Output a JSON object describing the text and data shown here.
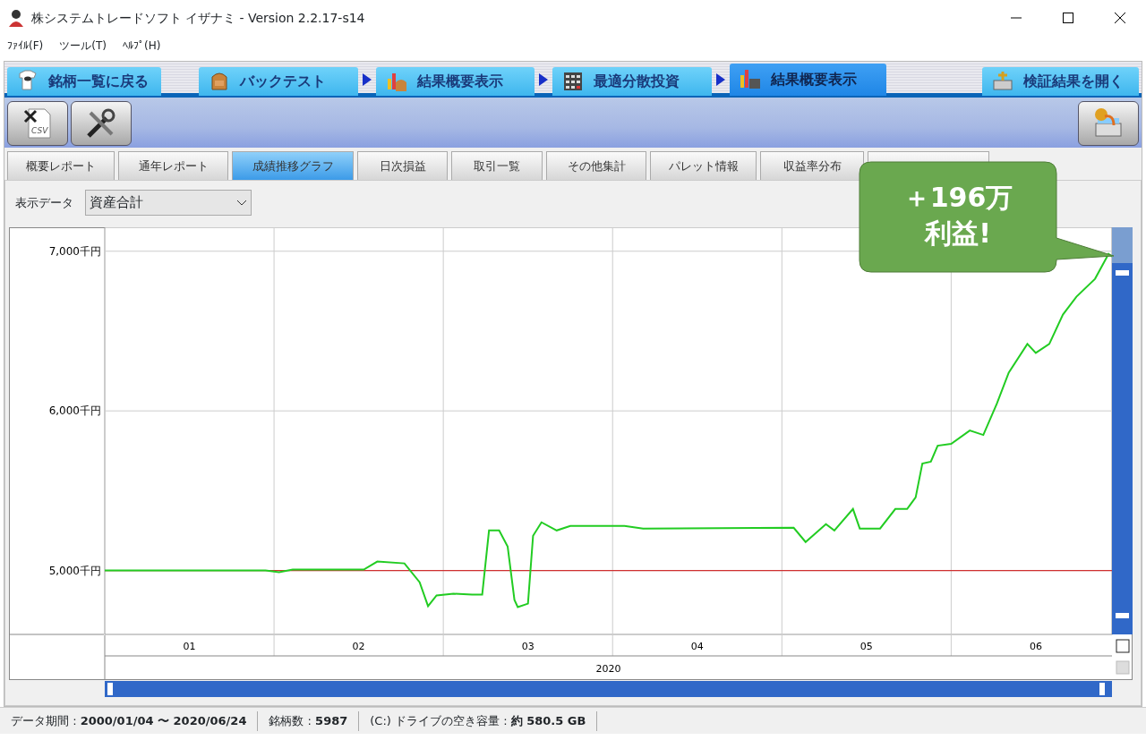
{
  "window": {
    "title": "株システムトレードソフト イザナミ - Version 2.2.17-s14"
  },
  "menu": [
    "ﾌｧｲﾙ(F)",
    "ツール(T)",
    "ﾍﾙﾌﾟ(H)"
  ],
  "workflow_tabs": [
    {
      "label": "銘柄一覧に戻る",
      "selected": false,
      "arrow": false
    },
    {
      "label": "バックテスト",
      "selected": false,
      "arrow": false
    },
    {
      "label": "結果概要表示",
      "selected": false,
      "arrow": true
    },
    {
      "label": "最適分散投資",
      "selected": false,
      "arrow": true
    },
    {
      "label": "結果概要表示",
      "selected": true,
      "arrow": true
    }
  ],
  "open_results_tab": {
    "label": "検証結果を開く"
  },
  "report_tabs": [
    {
      "label": "概要レポート",
      "selected": false
    },
    {
      "label": "通年レポート",
      "selected": false
    },
    {
      "label": "成績推移グラフ",
      "selected": true
    },
    {
      "label": "日次損益",
      "selected": false
    },
    {
      "label": "取引一覧",
      "selected": false
    },
    {
      "label": "その他集計",
      "selected": false
    },
    {
      "label": "パレット情報",
      "selected": false
    },
    {
      "label": "収益率分布",
      "selected": false
    },
    {
      "selected": false
    }
  ],
  "display_data": {
    "label": "表示データ",
    "value": "資産合計"
  },
  "toolbar": {
    "csv_label": "CSV"
  },
  "chart": {
    "chart_data": {
      "type": "line",
      "xlabel": "2020",
      "xlim": [
        0.5,
        6.45
      ],
      "ylim": [
        4600,
        7150
      ],
      "xticks": [
        {
          "value": 1,
          "label": "01"
        },
        {
          "value": 2,
          "label": "02"
        },
        {
          "value": 3,
          "label": "03"
        },
        {
          "value": 4,
          "label": "04"
        },
        {
          "value": 5,
          "label": "05"
        },
        {
          "value": 6,
          "label": "06"
        }
      ],
      "yticks": [
        {
          "value": 5000,
          "label": "5,000千円"
        },
        {
          "value": 6000,
          "label": "6,000千円"
        },
        {
          "value": 7000,
          "label": "7,000千円"
        }
      ],
      "x": [
        0.5,
        1.45,
        1.53,
        1.61,
        2.03,
        2.11,
        2.27,
        2.36,
        2.41,
        2.46,
        2.56,
        2.67,
        2.73,
        2.77,
        2.83,
        2.88,
        2.92,
        2.94,
        3,
        3.03,
        3.08,
        3.17,
        3.25,
        3.57,
        3.68,
        4.57,
        4.64,
        4.76,
        4.81,
        4.92,
        4.96,
        5.08,
        5.17,
        5.24,
        5.29,
        5.33,
        5.38,
        5.42,
        5.5,
        5.61,
        5.69,
        5.77,
        5.84,
        5.95,
        6,
        6.08,
        6.16,
        6.24,
        6.35,
        6.43,
        6.45
      ],
      "series": [
        {
          "color": "#22cc22",
          "values": [
            5000,
            5000,
            4989,
            5006,
            5006,
            5056,
            5045,
            4927,
            4777,
            4844,
            4855,
            4849,
            4849,
            5251,
            5251,
            5151,
            4816,
            4771,
            4793,
            5218,
            5302,
            5251,
            5279,
            5279,
            5263,
            5268,
            5179,
            5291,
            5251,
            5386,
            5263,
            5263,
            5386,
            5386,
            5458,
            5670,
            5682,
            5782,
            5793,
            5877,
            5849,
            6045,
            6240,
            6419,
            6363,
            6419,
            6603,
            6715,
            6827,
            6983,
            6967
          ]
        }
      ],
      "ref_lines": [
        {
          "axis": "y",
          "value": 5000
        }
      ]
    }
  },
  "callout": {
    "lines": [
      "＋196万",
      "利益!"
    ]
  },
  "status_bar": [
    "データ期間 : **2000/01/04 〜 2020/06/24**",
    "銘柄数 : **5987**",
    "(C:) ドライブの空き容量 : **約 580.5 GB**"
  ]
}
